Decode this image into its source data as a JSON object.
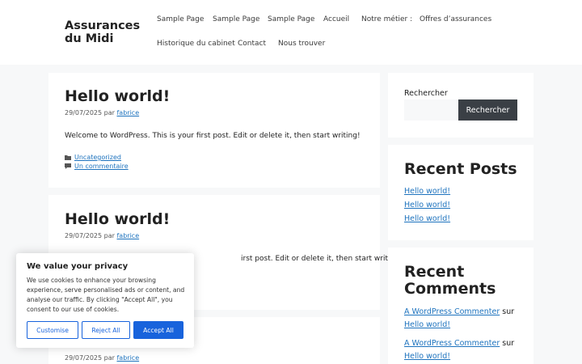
{
  "site": {
    "title": "Assurances du Midi"
  },
  "nav": {
    "items": [
      "Sample Page",
      "Sample Page",
      "Sample Page",
      "Accueil",
      "Notre métier :",
      "Offres d’assurances",
      "Historique du cabinet",
      "Contact",
      "Nous trouver"
    ]
  },
  "posts": [
    {
      "title": "Hello world!",
      "date": "29/07/2025",
      "by": "par",
      "author": "fabrice",
      "excerpt": "Welcome to WordPress. This is your first post. Edit or delete it, then start writing!",
      "category": "Uncategorized",
      "comments": "Un commentaire"
    },
    {
      "title": "Hello world!",
      "date": "29/07/2025",
      "by": "par",
      "author": "fabrice",
      "excerpt_visible": "irst post. Edit or delete it, then start writing!"
    },
    {
      "date": "29/07/2025",
      "by": "par",
      "author": "fabrice"
    }
  ],
  "sidebar": {
    "search": {
      "label": "Rechercher",
      "button": "Rechercher"
    },
    "recent_posts": {
      "title": "Recent Posts",
      "links": [
        "Hello world!",
        "Hello world!",
        "Hello world!"
      ]
    },
    "recent_comments": {
      "title_line1": "Recent",
      "title_line2": "Comments",
      "items": [
        {
          "author": "A WordPress Commenter",
          "on": "sur",
          "post": "Hello world!"
        },
        {
          "author": "A WordPress Commenter",
          "on": "sur",
          "post": "Hello world!"
        }
      ]
    }
  },
  "cookie": {
    "title": "We value your privacy",
    "text": "We use cookies to enhance your browsing experience, serve personalised ads or content, and analyse our traffic. By clicking \"Accept All\", you consent to our use of cookies.",
    "customise": "Customise",
    "reject": "Reject All",
    "accept": "Accept All"
  },
  "colors": {
    "link": "#1e73be",
    "accent_button": "#1863dc",
    "search_button": "#3a3f45"
  },
  "icons": {
    "category": "folder-icon",
    "comments": "comment-icon"
  }
}
